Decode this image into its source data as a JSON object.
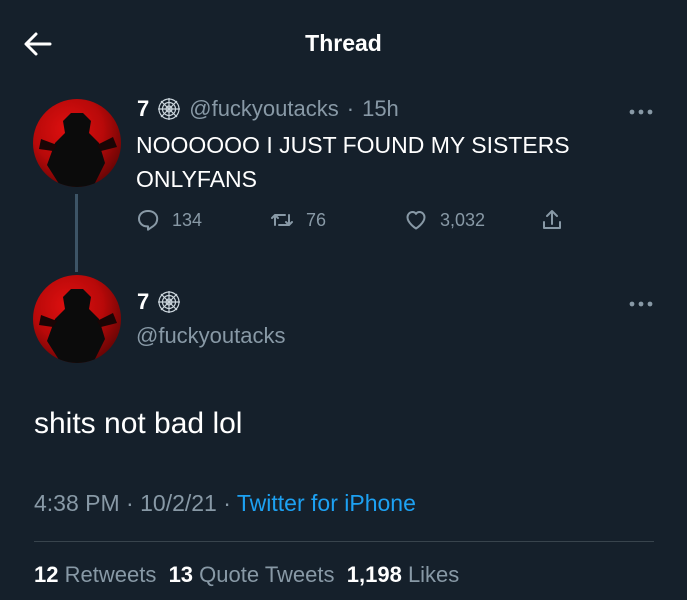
{
  "header": {
    "title": "Thread"
  },
  "parent_tweet": {
    "name": "7",
    "handle": "@fuckyoutacks",
    "separator": "·",
    "time": "15h",
    "text_line1": "NOOOOOO I JUST FOUND MY SISTERS",
    "text_line2": "ONLYFANS",
    "replies": "134",
    "retweets": "76",
    "likes": "3,032"
  },
  "main_tweet": {
    "name": "7",
    "handle": "@fuckyoutacks",
    "text": "shits not bad lol",
    "time": "4:38 PM",
    "sep1": "·",
    "date": "10/2/21",
    "sep2": "·",
    "source": "Twitter for iPhone"
  },
  "stats": {
    "retweets_count": "12",
    "retweets_label": "Retweets",
    "quotes_count": "13",
    "quotes_label": "Quote Tweets",
    "likes_count": "1,198",
    "likes_label": "Likes"
  },
  "colors": {
    "background": "#15202b",
    "secondary_text": "#8899a6",
    "accent": "#1da1f2",
    "divider": "#38444d"
  }
}
